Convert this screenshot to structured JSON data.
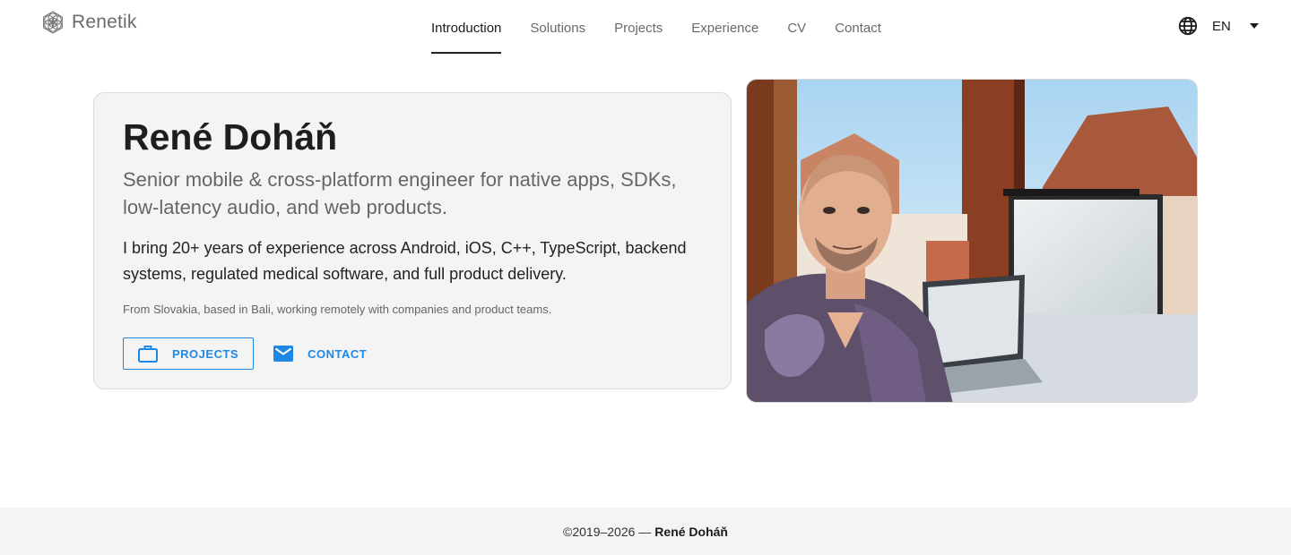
{
  "brand": {
    "name": "Renetik",
    "icon": "flower-of-life-icon"
  },
  "nav": {
    "items": [
      {
        "label": "Introduction",
        "active": true
      },
      {
        "label": "Solutions",
        "active": false
      },
      {
        "label": "Projects",
        "active": false
      },
      {
        "label": "Experience",
        "active": false
      },
      {
        "label": "CV",
        "active": false
      },
      {
        "label": "Contact",
        "active": false
      }
    ]
  },
  "language": {
    "icon": "globe-icon",
    "code": "EN",
    "dropdown_icon": "caret-down-icon"
  },
  "intro": {
    "name": "René Doháň",
    "subtitle": "Senior mobile & cross-platform engineer for native apps, SDKs, low-latency audio, and web products.",
    "description": "I bring 20+ years of experience across Android, iOS, C++, TypeScript, backend systems, regulated medical software, and full product delivery.",
    "location": "From Slovakia, based in Bali, working remotely with companies and product teams.",
    "buttons": {
      "projects": {
        "label": "PROJECTS",
        "icon": "briefcase-icon"
      },
      "contact": {
        "label": "CONTACT",
        "icon": "mail-icon"
      }
    }
  },
  "photo": {
    "description_icon": "portrait-photo"
  },
  "footer": {
    "copyright": "©2019–2026 —",
    "owner": "René Doháň"
  },
  "colors": {
    "accent": "#1e88e5",
    "card_bg": "#f4f4f5",
    "footer_bg": "#f4f4f5",
    "text_muted": "#666666"
  }
}
